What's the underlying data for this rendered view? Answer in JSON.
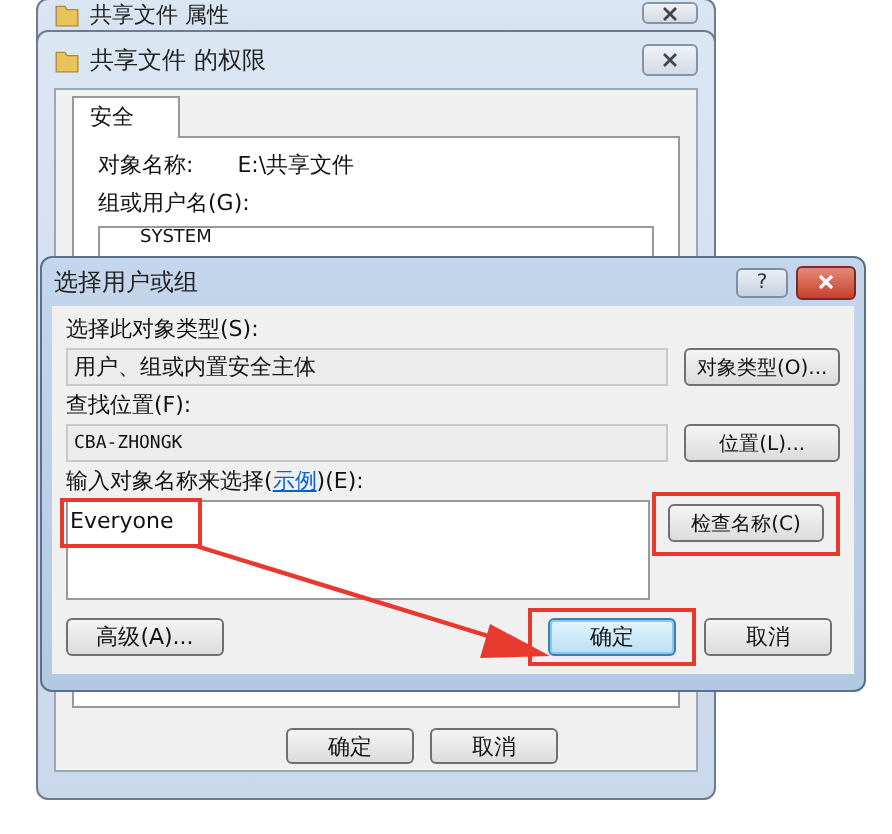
{
  "back_window": {
    "title": "共享文件 属性"
  },
  "permissions_window": {
    "title": "共享文件 的权限",
    "tabs": [
      {
        "label": "安全",
        "selected": true
      }
    ],
    "object_label": "对象名称:",
    "object_value": "E:\\共享文件",
    "group_label": "组或用户名(G):",
    "users": [
      "SYSTEM"
    ],
    "buttons": [
      "确定",
      "取消"
    ]
  },
  "dialog": {
    "title": "选择用户或组",
    "help_button": "?",
    "object_type": {
      "label": "选择此对象类型(S):",
      "value": "用户、组或内置安全主体",
      "button": "对象类型(O)..."
    },
    "location": {
      "label": "查找位置(F):",
      "value": "CBA-ZHONGK",
      "button": "位置(L)..."
    },
    "names": {
      "label_start": "输入对象名称来选择(",
      "link": "示例",
      "label_end": ")(E):",
      "value": "Everyone",
      "highlighted": true,
      "button": "检查名称(C)",
      "button_highlighted": true
    },
    "footer": [
      {
        "label": "高级(A)...",
        "kind": "plain",
        "highlighted": false
      },
      {
        "label": "确定",
        "kind": "default",
        "highlighted": true
      },
      {
        "label": "取消",
        "kind": "plain",
        "highlighted": false
      }
    ]
  }
}
